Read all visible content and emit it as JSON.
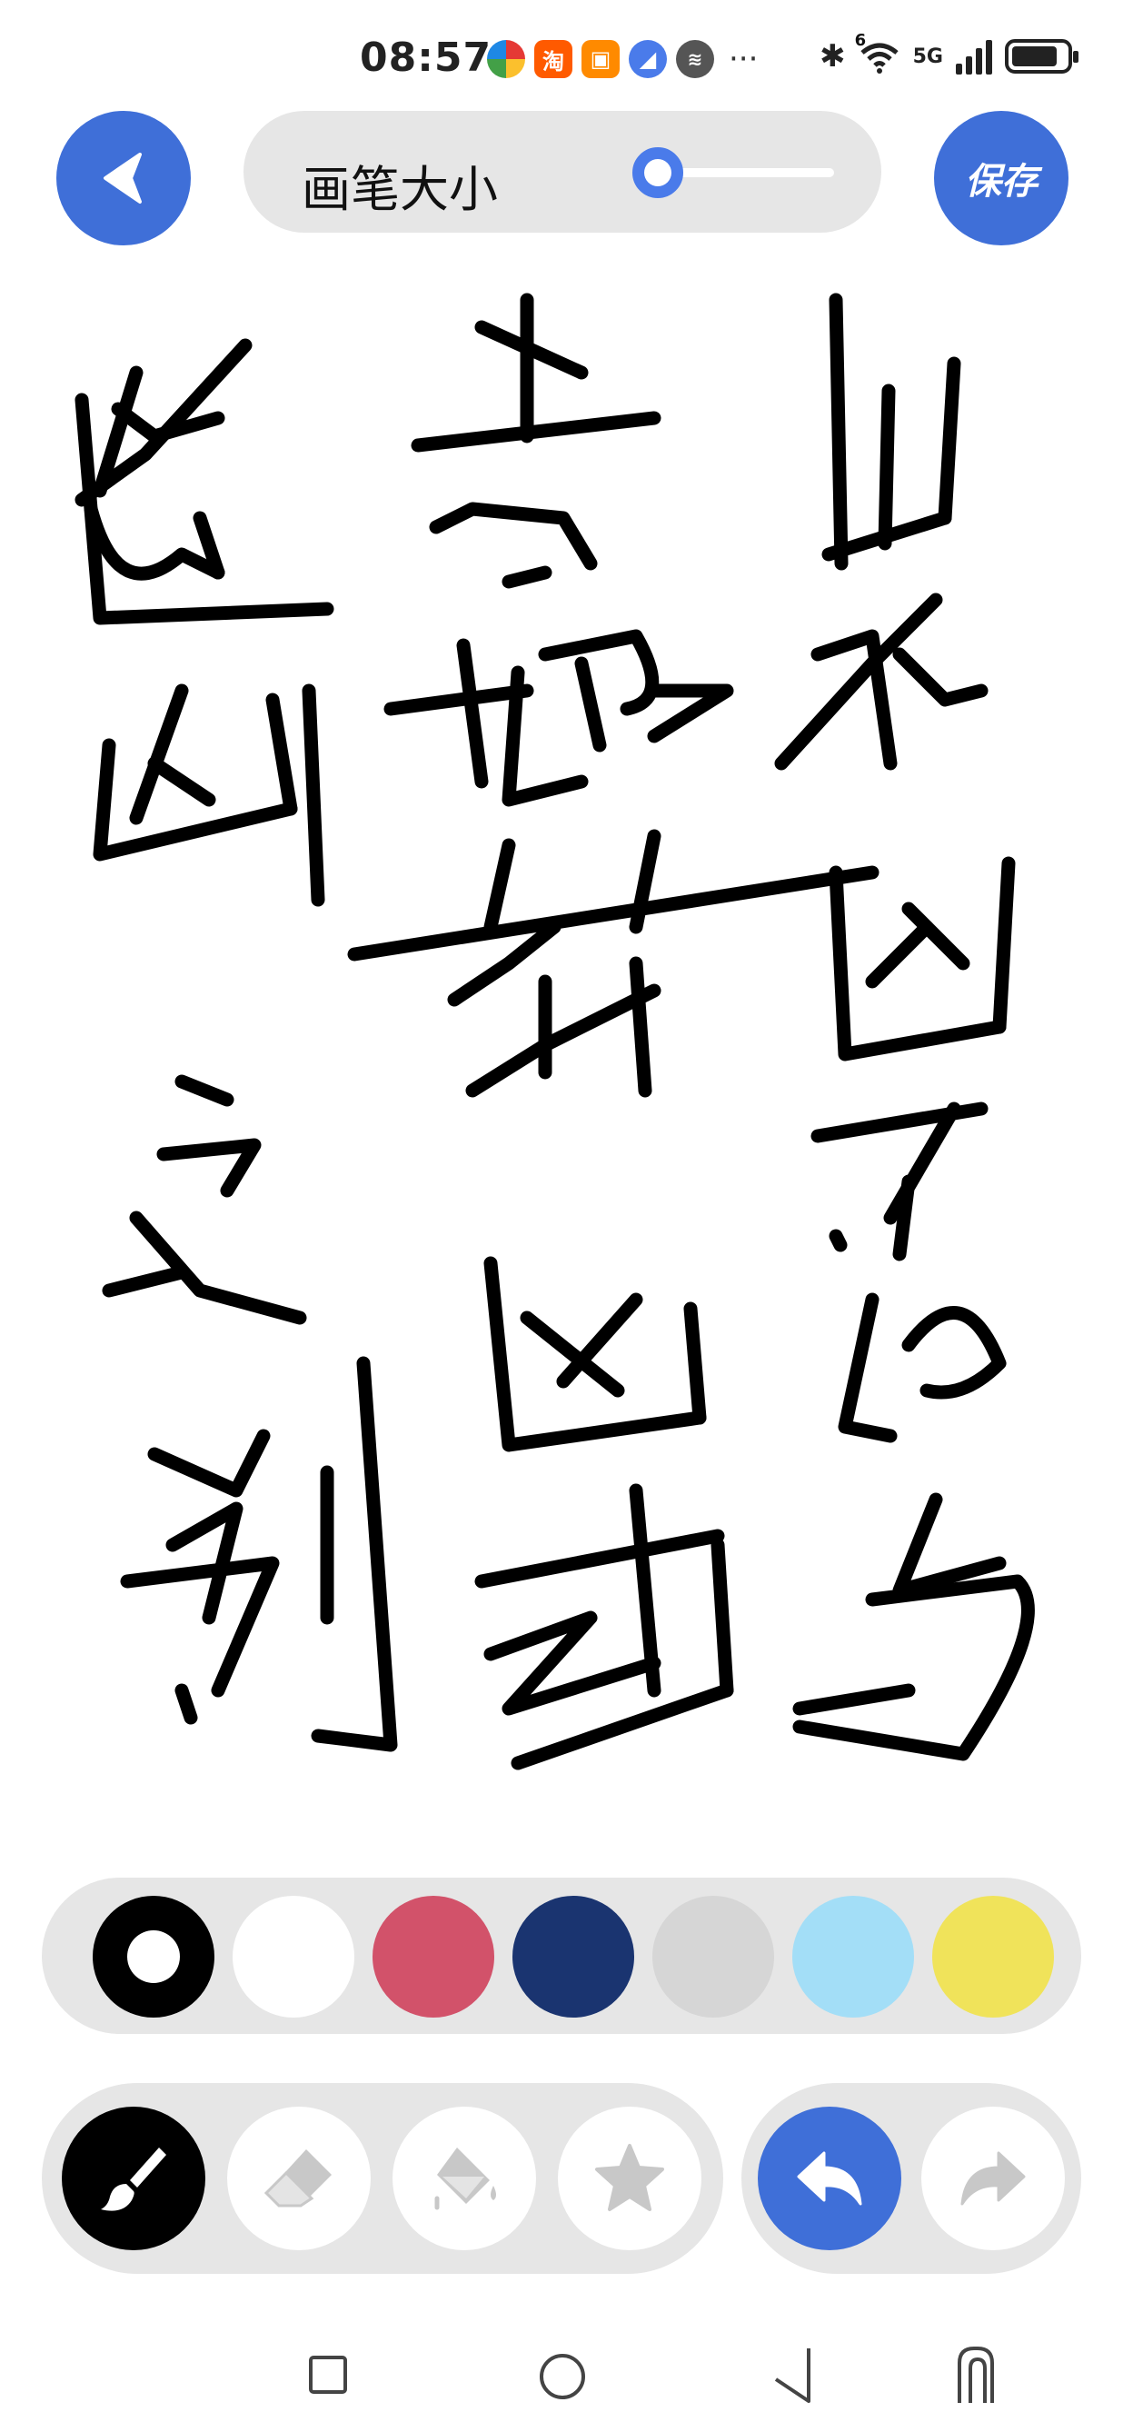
{
  "status_bar": {
    "time": "08:57",
    "app_icons": [
      "qq-browser-icon",
      "taobao-icon",
      "red-envelope-icon",
      "blue-app-icon",
      "voice-icon"
    ],
    "taobao_label": "淘",
    "more": "···",
    "network_label": "5G",
    "wifi_label": "6",
    "battery_level": 0.85
  },
  "toolbar": {
    "back_icon": "back-arrow-icon",
    "brush_size_label": "画笔大小",
    "brush_size_value": 0.1,
    "save_label": "保存"
  },
  "canvas": {
    "stroke_color": "#000000",
    "handwritten_text": "山水凶恶与吉地葬凶或造凶之别"
  },
  "palette": {
    "selected_index": 0,
    "colors": [
      "#000000",
      "#ffffff",
      "#d2526a",
      "#1a3470",
      "#d6d6d6",
      "#a3def7",
      "#f0e35a"
    ]
  },
  "tools": {
    "draw": [
      "brush-tool",
      "eraser-tool",
      "fill-bucket-tool",
      "stamp-star-tool"
    ],
    "history": [
      "undo-button",
      "redo-button"
    ],
    "active_tool": "brush-tool",
    "colors": {
      "active_bg": "#000000",
      "accent": "#3f6fd8",
      "inactive_icon": "#c8c8c8"
    }
  },
  "nav_bar": [
    "recents-icon",
    "home-icon",
    "back-icon",
    "extra-icon"
  ]
}
